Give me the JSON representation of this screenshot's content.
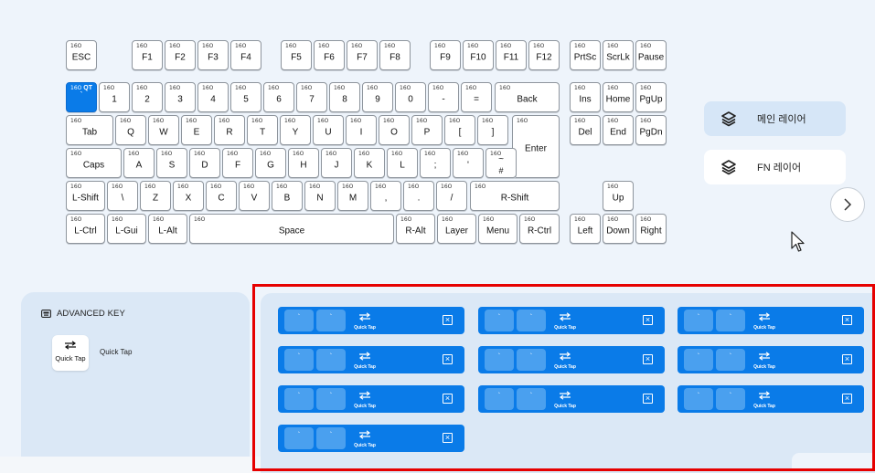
{
  "keyboard": {
    "tag": "16O",
    "selected_qt": "QT",
    "row_fn": [
      "ESC",
      "F1",
      "F2",
      "F3",
      "F4",
      "F5",
      "F6",
      "F7",
      "F8",
      "F9",
      "F10",
      "F11",
      "F12",
      "PrtSc",
      "ScrLk",
      "Pause"
    ],
    "row_num": [
      "`",
      "1",
      "2",
      "3",
      "4",
      "5",
      "6",
      "7",
      "8",
      "9",
      "0",
      "-",
      "=",
      "Back",
      "Ins",
      "Home",
      "PgUp"
    ],
    "row_q": [
      "Tab",
      "Q",
      "W",
      "E",
      "R",
      "T",
      "Y",
      "U",
      "I",
      "O",
      "P",
      "[",
      "]",
      "Del",
      "End",
      "PgDn"
    ],
    "row_a": [
      "Caps",
      "A",
      "S",
      "D",
      "F",
      "G",
      "H",
      "J",
      "K",
      "L",
      ";",
      "'",
      "#",
      "Enter"
    ],
    "row_a_hash_top": "~",
    "row_z": [
      "L-Shift",
      "\\",
      "Z",
      "X",
      "C",
      "V",
      "B",
      "N",
      "M",
      ",",
      ".",
      "/",
      "R-Shift",
      "Up"
    ],
    "row_ctrl": [
      "L-Ctrl",
      "L-Gui",
      "L-Alt",
      "Space",
      "R-Alt",
      "Layer",
      "Menu",
      "R-Ctrl",
      "Left",
      "Down",
      "Right"
    ]
  },
  "layers": {
    "main": "메인 레이어",
    "fn": "FN 레이어"
  },
  "advanced": {
    "title": "ADVANCED KEY",
    "card_label": "Quick Tap",
    "description": "Quick Tap"
  },
  "slots": [
    {
      "k1": "`",
      "k2": "`",
      "type": "Quick Tap"
    },
    {
      "k1": "`",
      "k2": "`",
      "type": "Quick Tap"
    },
    {
      "k1": "`",
      "k2": "`",
      "type": "Quick Tap"
    },
    {
      "k1": "`",
      "k2": "`",
      "type": "Quick Tap"
    },
    {
      "k1": "`",
      "k2": "`",
      "type": "Quick Tap"
    },
    {
      "k1": "`",
      "k2": "`",
      "type": "Quick Tap"
    },
    {
      "k1": "`",
      "k2": "`",
      "type": "Quick Tap"
    },
    {
      "k1": "`",
      "k2": "`",
      "type": "Quick Tap"
    },
    {
      "k1": "`",
      "k2": "`",
      "type": "Quick Tap"
    },
    {
      "k1": "`",
      "k2": "`",
      "type": "Quick Tap"
    }
  ],
  "colors": {
    "accent": "#0a7be8",
    "highlight_frame": "#e60000",
    "panel": "#dbe8f6",
    "background": "#eef4fb"
  }
}
